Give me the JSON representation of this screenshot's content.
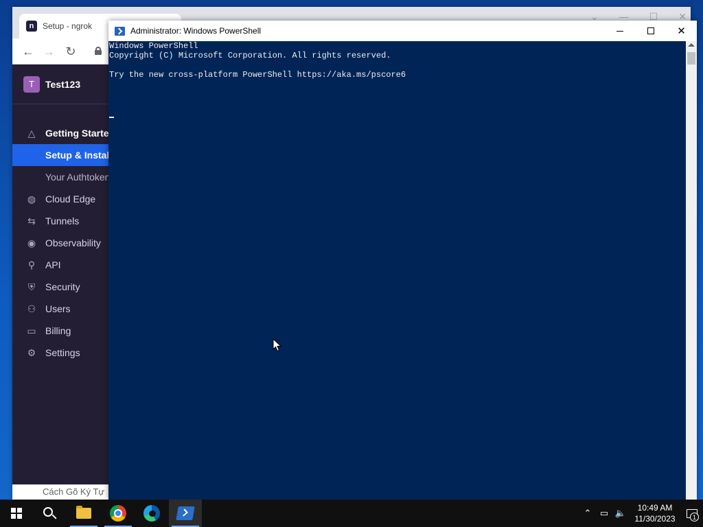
{
  "chrome": {
    "tab_title": "Setup - ngrok",
    "logo_letter": "n",
    "window_controls": [
      "minimize-icon",
      "maximize-icon",
      "close-icon"
    ],
    "nav": {
      "back": "←",
      "forward": "→",
      "reload": "↻"
    },
    "bottom_strip_text": "Cách Gõ Ký Tự"
  },
  "ngrok": {
    "account": {
      "avatar_letter": "T",
      "name": "Test123"
    },
    "nav": [
      {
        "label": "Getting Started",
        "icon": "rocket-icon",
        "glyph": "△",
        "style": "bold"
      },
      {
        "label": "Setup & Installation",
        "icon": "",
        "glyph": "",
        "style": "active"
      },
      {
        "label": "Your Authtoken",
        "icon": "",
        "glyph": "",
        "style": "sub"
      },
      {
        "label": "Cloud Edge",
        "icon": "globe-icon",
        "glyph": "◍",
        "style": "normal"
      },
      {
        "label": "Tunnels",
        "icon": "arrows-icon",
        "glyph": "⇆",
        "style": "normal"
      },
      {
        "label": "Observability",
        "icon": "eye-icon",
        "glyph": "◉",
        "style": "normal"
      },
      {
        "label": "API",
        "icon": "plug-icon",
        "glyph": "⚲",
        "style": "normal"
      },
      {
        "label": "Security",
        "icon": "shield-icon",
        "glyph": "⛨",
        "style": "normal"
      },
      {
        "label": "Users",
        "icon": "users-icon",
        "glyph": "⚇",
        "style": "normal"
      },
      {
        "label": "Billing",
        "icon": "card-icon",
        "glyph": "▭",
        "style": "normal"
      },
      {
        "label": "Settings",
        "icon": "gear-icon",
        "glyph": "⚙",
        "style": "normal"
      }
    ]
  },
  "powershell": {
    "title": "Administrator: Windows PowerShell",
    "lines": [
      "Windows PowerShell",
      "Copyright (C) Microsoft Corporation. All rights reserved.",
      "",
      "Try the new cross-platform PowerShell https://aka.ms/pscore6",
      ""
    ],
    "colors": {
      "background": "#012456",
      "text": "#eeedf0"
    }
  },
  "taskbar": {
    "apps": [
      {
        "name": "start-button"
      },
      {
        "name": "search-button"
      },
      {
        "name": "file-explorer"
      },
      {
        "name": "google-chrome"
      },
      {
        "name": "microsoft-edge"
      },
      {
        "name": "windows-powershell",
        "active": true
      }
    ],
    "tray": {
      "chevron": "⌃",
      "network": "▭",
      "volume": "🔈",
      "time": "10:49 AM",
      "date": "11/30/2023",
      "notification_count": "1"
    }
  }
}
